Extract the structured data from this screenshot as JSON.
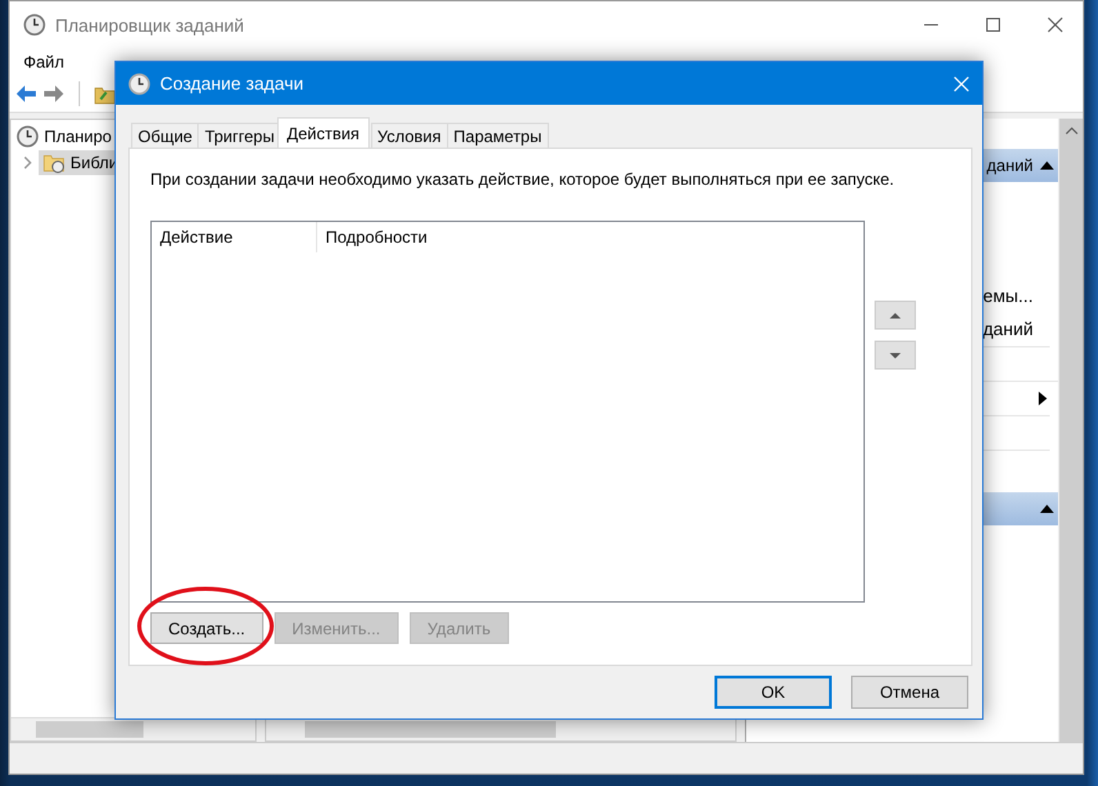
{
  "background_window": {
    "title": "Планировщик заданий",
    "menu": [
      "Файл"
    ],
    "tree": [
      {
        "label": "Планиро",
        "children": [
          {
            "label": "Библи",
            "selected": true
          }
        ]
      }
    ],
    "actions_pane": {
      "sections": [
        {
          "header": "даний",
          "expanded": true,
          "items": [
            "емы...",
            "даний"
          ]
        },
        {
          "expanded": true
        }
      ]
    }
  },
  "dialog": {
    "title": "Создание задачи",
    "tabs": [
      {
        "label": "Общие",
        "selected": false
      },
      {
        "label": "Триггеры",
        "selected": false
      },
      {
        "label": "Действия",
        "selected": true
      },
      {
        "label": "Условия",
        "selected": false
      },
      {
        "label": "Параметры",
        "selected": false
      }
    ],
    "description": "При создании задачи необходимо указать действие, которое будет выполняться при ее запуске.",
    "list": {
      "columns": [
        "Действие",
        "Подробности"
      ]
    },
    "buttons": [
      {
        "label": "Создать...",
        "disabled": false,
        "highlighted": true
      },
      {
        "label": "Изменить...",
        "disabled": true,
        "highlighted": false
      },
      {
        "label": "Удалить",
        "disabled": true,
        "highlighted": false
      }
    ],
    "footer_buttons": [
      {
        "label": "OK",
        "default": true
      },
      {
        "label": "Отмена",
        "default": false
      }
    ]
  }
}
